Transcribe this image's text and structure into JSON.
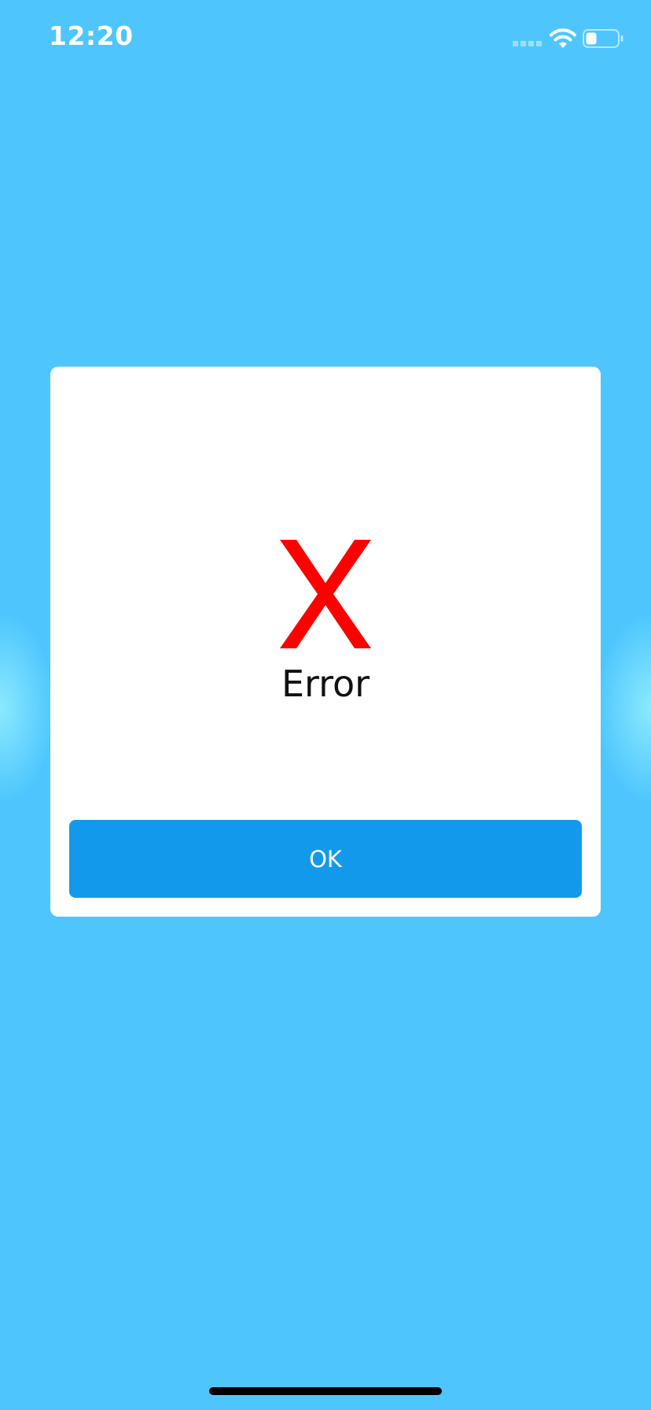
{
  "status_bar": {
    "time": "12:20",
    "icons": [
      "signal-icon",
      "wifi-icon",
      "battery-icon"
    ]
  },
  "dialog": {
    "icon": "error-x-icon",
    "icon_glyph": "X",
    "icon_color": "#ff0000",
    "title": "Error",
    "ok_label": "OK",
    "button_color": "#1399ec"
  },
  "colors": {
    "background": "#4ec6fd",
    "dialog": "#ffffff"
  }
}
